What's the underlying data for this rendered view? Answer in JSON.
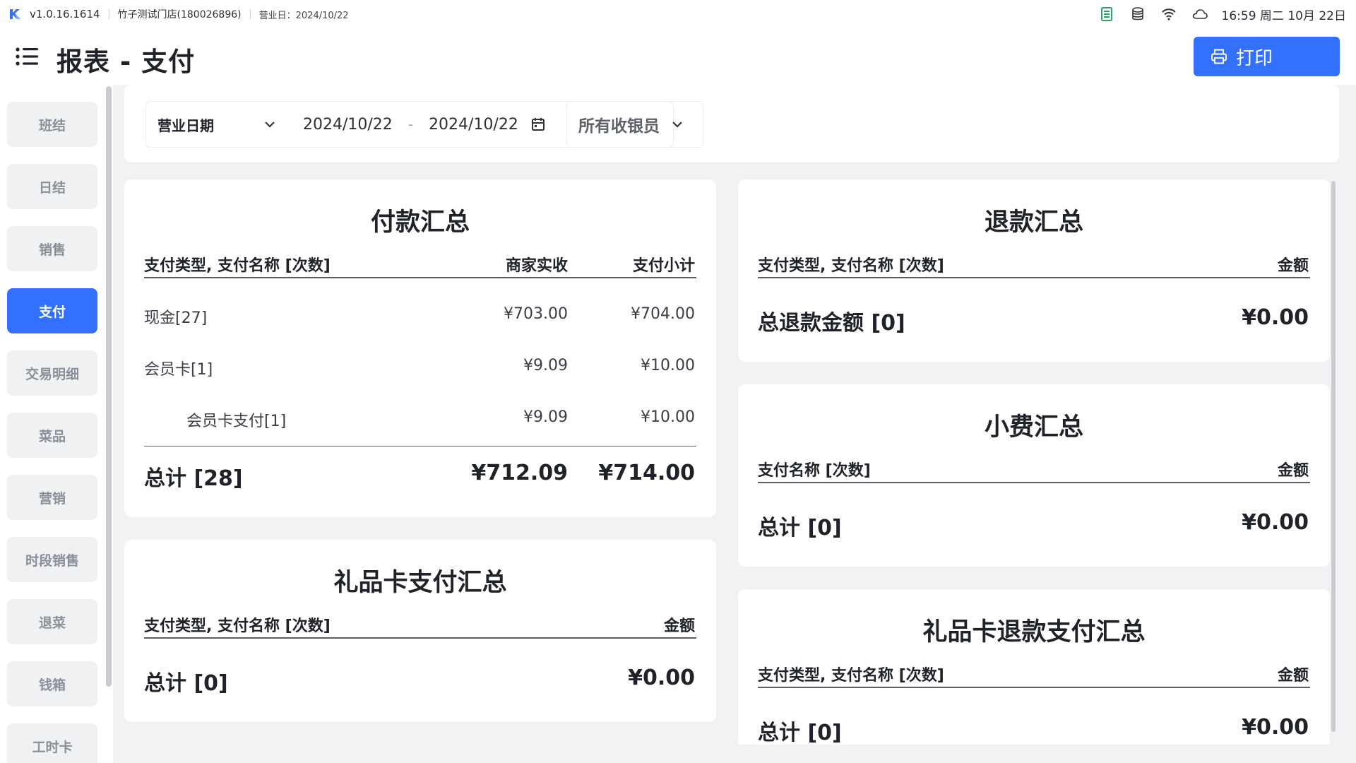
{
  "statusbar": {
    "version": "v1.0.16.1614",
    "store": "竹子测试门店(180026896)",
    "business_date": "营业日：2024/10/22",
    "clock": "16:59 周二 10月 22日",
    "icons": [
      "receipt-icon",
      "database-icon",
      "wifi-icon",
      "cloud-icon"
    ],
    "accent": "#3370ff"
  },
  "header": {
    "title": "报表 - 支付",
    "print_label": "打印"
  },
  "sidebar": {
    "items": [
      {
        "label": "班结"
      },
      {
        "label": "日结"
      },
      {
        "label": "销售"
      },
      {
        "label": "支付",
        "active": true
      },
      {
        "label": "交易明细"
      },
      {
        "label": "菜品"
      },
      {
        "label": "营销"
      },
      {
        "label": "时段销售"
      },
      {
        "label": "退菜"
      },
      {
        "label": "钱箱"
      },
      {
        "label": "工时卡"
      }
    ]
  },
  "filters": {
    "date_type": "营业日期",
    "start_date": "2024/10/22",
    "separator": "-",
    "end_date": "2024/10/22",
    "cashier": "所有收银员"
  },
  "payment_summary": {
    "title": "付款汇总",
    "headers": [
      "支付类型, 支付名称 [次数]",
      "商家实收",
      "支付小计"
    ],
    "rows": [
      {
        "name": "现金[27]",
        "received": "¥703.00",
        "subtotal": "¥704.00"
      },
      {
        "name": "会员卡[1]",
        "received": "¥9.09",
        "subtotal": "¥10.00"
      },
      {
        "name": "会员卡支付[1]",
        "received": "¥9.09",
        "subtotal": "¥10.00"
      }
    ],
    "total": {
      "label": "总计 [28]",
      "received": "¥712.09",
      "subtotal": "¥714.00"
    }
  },
  "giftcard_payment": {
    "title": "礼品卡支付汇总",
    "headers": [
      "支付类型, 支付名称 [次数]",
      "金额"
    ],
    "total": {
      "label": "总计 [0]",
      "amount": "¥0.00"
    }
  },
  "refund_summary": {
    "title": "退款汇总",
    "headers": [
      "支付类型, 支付名称 [次数]",
      "金额"
    ],
    "total": {
      "label": "总退款金额 [0]",
      "amount": "¥0.00"
    }
  },
  "tip_summary": {
    "title": "小费汇总",
    "headers": [
      "支付名称 [次数]",
      "金额"
    ],
    "total": {
      "label": "总计 [0]",
      "amount": "¥0.00"
    }
  },
  "giftcard_refund": {
    "title": "礼品卡退款支付汇总",
    "headers": [
      "支付类型, 支付名称 [次数]",
      "金额"
    ],
    "total": {
      "label": "总计 [0]",
      "amount": "¥0.00"
    }
  }
}
